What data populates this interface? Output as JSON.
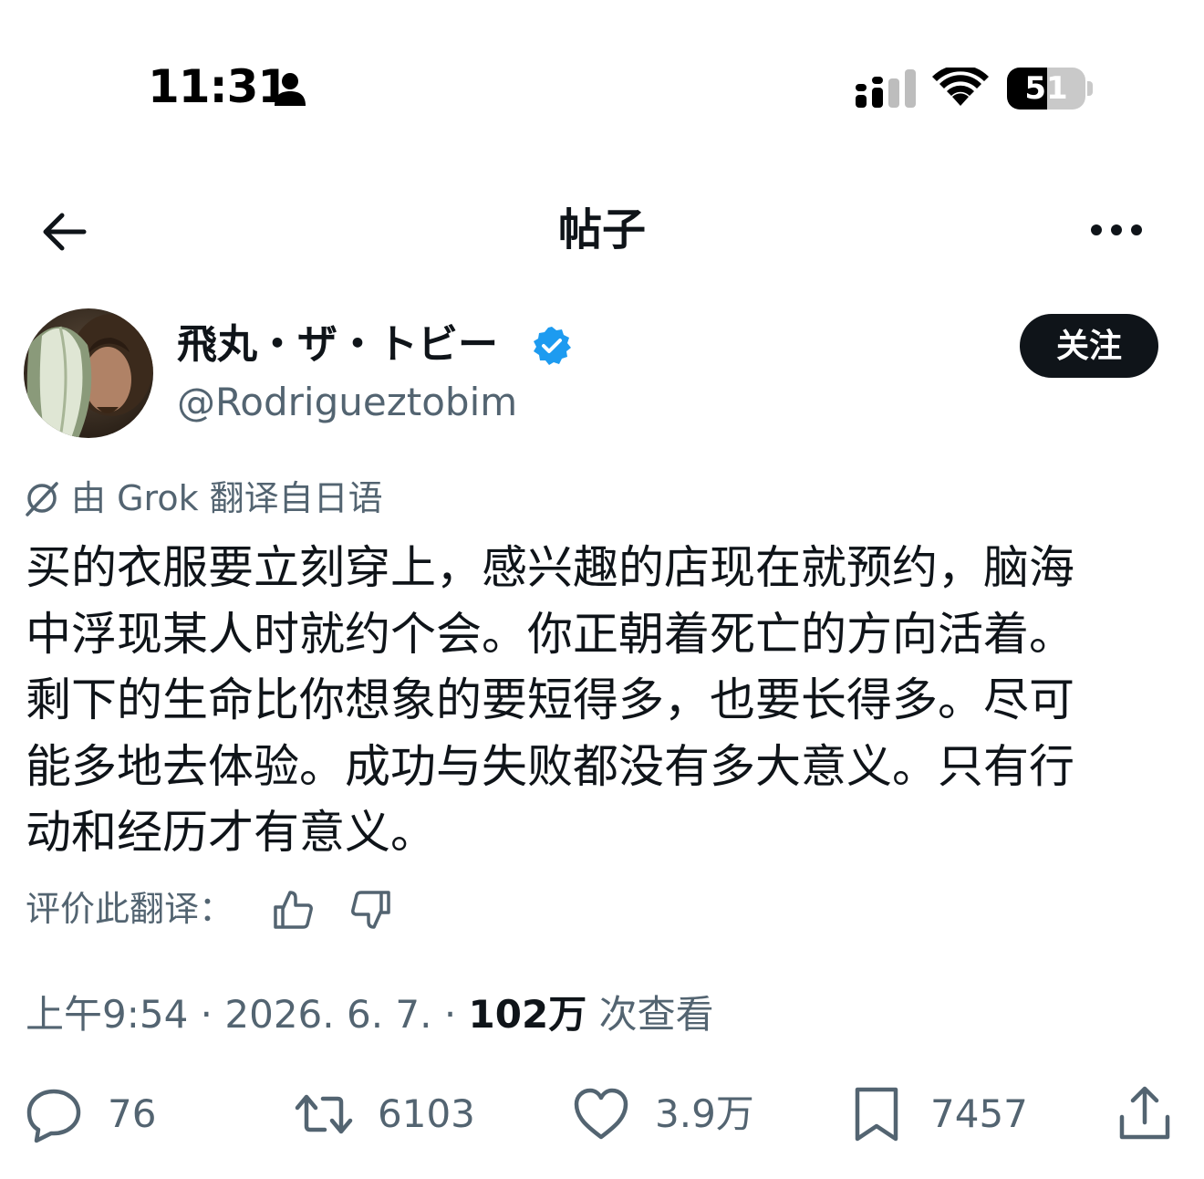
{
  "status_bar": {
    "time": "11:31",
    "battery_level": "51",
    "battery_fraction": 0.51
  },
  "header": {
    "title": "帖子"
  },
  "author": {
    "display_name": "飛丸・ザ・トビー",
    "handle": "@Rodrigueztobim",
    "verified": true,
    "follow_label": "关注"
  },
  "translation": {
    "note": "由 Grok 翻译自日语",
    "rate_label": "评价此翻译："
  },
  "post": {
    "text_lines": [
      "买的衣服要立刻穿上，感兴趣的店现在就预约，脑海",
      "中浮现某人时就约个会。你正朝着死亡的方向活着。",
      "剩下的生命比你想象的要短得多，也要长得多。尽可",
      "能多地去体验。成功与失败都没有多大意义。只有行",
      "动和经历才有意义。"
    ]
  },
  "meta": {
    "time": "上午9:54",
    "sep1": " · ",
    "date": "2026. 6. 7.",
    "sep2": " · ",
    "views": "102万",
    "views_label": " 次查看"
  },
  "actions": {
    "replies": "76",
    "reposts": "6103",
    "likes": "3.9万",
    "bookmarks": "7457"
  },
  "colors": {
    "text": "#0f1419",
    "secondary": "#536471",
    "verified": "#1d9bf0",
    "follow_bg": "#0f1419"
  }
}
